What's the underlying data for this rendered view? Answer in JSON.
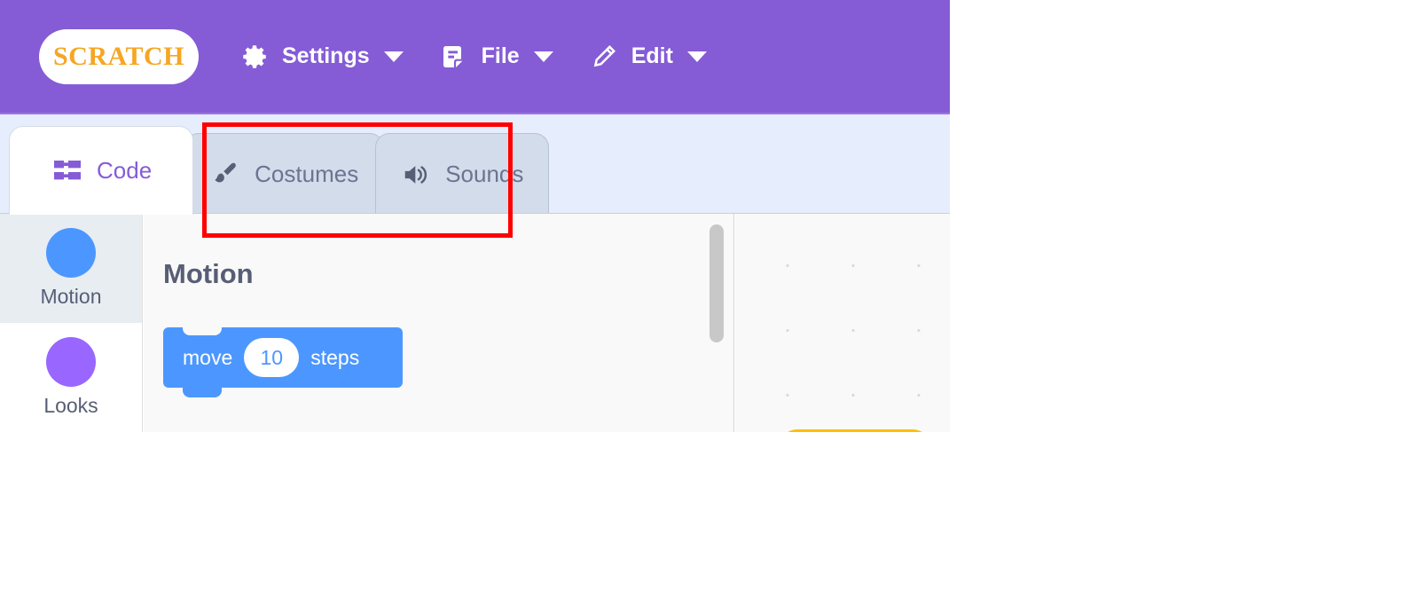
{
  "app": {
    "name": "Scratch",
    "logo_text": "SCRATCH"
  },
  "colors": {
    "menubar_purple": "#855CD6",
    "tabbar_blue": "#E6EDFC",
    "tab_inactive": "#D2DCEB",
    "motion_blue": "#4C97FF",
    "looks_purple": "#9966FF",
    "events_yellow": "#FFBF00",
    "text_gray": "#575E75",
    "annotation_red": "#FF0000"
  },
  "menubar": {
    "items": [
      {
        "label": "Settings",
        "icon": "gear-icon",
        "has_caret": true
      },
      {
        "label": "File",
        "icon": "file-icon",
        "has_caret": true
      },
      {
        "label": "Edit",
        "icon": "pencil-icon",
        "has_caret": true
      }
    ]
  },
  "tabs": [
    {
      "label": "Code",
      "icon": "code-blocks-icon",
      "active": true
    },
    {
      "label": "Costumes",
      "icon": "paintbrush-icon",
      "active": false
    },
    {
      "label": "Sounds",
      "icon": "speaker-icon",
      "active": false
    }
  ],
  "categories": [
    {
      "label": "Motion",
      "color": "#4C97FF",
      "selected": true
    },
    {
      "label": "Looks",
      "color": "#9966FF",
      "selected": false
    }
  ],
  "palette": {
    "heading": "Motion",
    "blocks": [
      {
        "prefix": "move",
        "value": "10",
        "suffix": "steps"
      }
    ]
  },
  "annotation": {
    "target": "Costumes",
    "shape": "rectangle",
    "color": "#FF0000"
  }
}
